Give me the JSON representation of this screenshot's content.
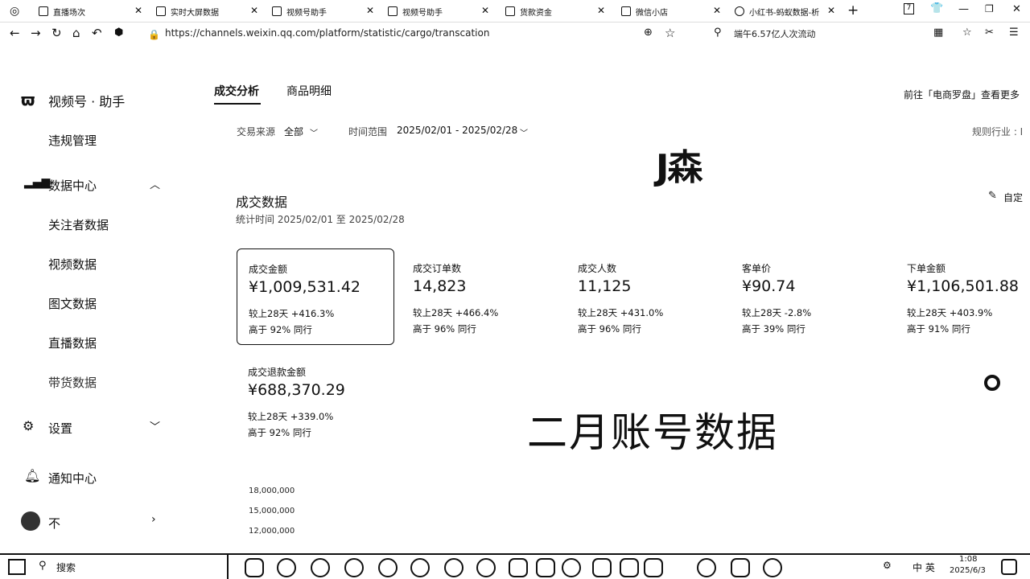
{
  "browser": {
    "tabs": [
      {
        "label": "直播场次"
      },
      {
        "label": "实时大屏数据"
      },
      {
        "label": "视频号助手"
      },
      {
        "label": "视频号助手"
      },
      {
        "label": "货款资金"
      },
      {
        "label": "微信小店"
      },
      {
        "label": "小红书-蚂蚁数据-析"
      }
    ],
    "url": "https://channels.weixin.qq.com/platform/statistic/cargo/transcation",
    "search_text": "端午6.57亿人次流动"
  },
  "sidebar": {
    "brand": "视频号 · 助手",
    "items": [
      {
        "label": "违规管理"
      },
      {
        "label": "数据中心"
      },
      {
        "label": "关注者数据"
      },
      {
        "label": "视频数据"
      },
      {
        "label": "图文数据"
      },
      {
        "label": "直播数据"
      },
      {
        "label": "带货数据"
      },
      {
        "label": "设置"
      },
      {
        "label": "通知中心"
      },
      {
        "label": "不"
      }
    ]
  },
  "main": {
    "tabs": [
      {
        "label": "成交分析"
      },
      {
        "label": "商品明细"
      }
    ],
    "top_right_link": "前往「电商罗盘」查看更多",
    "filters": {
      "source_label": "交易来源",
      "source_value": "全部",
      "range_label": "时间范围",
      "range_value": "2025/02/01 - 2025/02/28",
      "industry_label": "规则行业 : I"
    },
    "watermark_top": "J森",
    "watermark_mid": "二月账号数据",
    "section_title": "成交数据",
    "section_sub": "统计时间 2025/02/01 至 2025/02/28",
    "customize": "自定",
    "metrics": [
      {
        "label": "成交金额",
        "value": "¥1,009,531.42",
        "compare": "较上28天 +416.3%",
        "rank": "高于 92% 同行"
      },
      {
        "label": "成交订单数",
        "value": "14,823",
        "compare": "较上28天 +466.4%",
        "rank": "高于 96% 同行"
      },
      {
        "label": "成交人数",
        "value": "11,125",
        "compare": "较上28天 +431.0%",
        "rank": "高于 96% 同行"
      },
      {
        "label": "客单价",
        "value": "¥90.74",
        "compare": "较上28天 -2.8%",
        "rank": "高于 39% 同行"
      },
      {
        "label": "下单金额",
        "value": "¥1,106,501.88",
        "compare": "较上28天 +403.9%",
        "rank": "高于 91% 同行"
      },
      {
        "label": "成交退款金额",
        "value": "¥688,370.29",
        "compare": "较上28天 +339.0%",
        "rank": "高于 92% 同行"
      }
    ],
    "y_ticks": [
      "18,000,000",
      "15,000,000",
      "12,000,000"
    ]
  },
  "taskbar": {
    "search_placeholder": "搜索",
    "ime": "中 英",
    "time": "1:08",
    "date": "2025/6/3"
  }
}
